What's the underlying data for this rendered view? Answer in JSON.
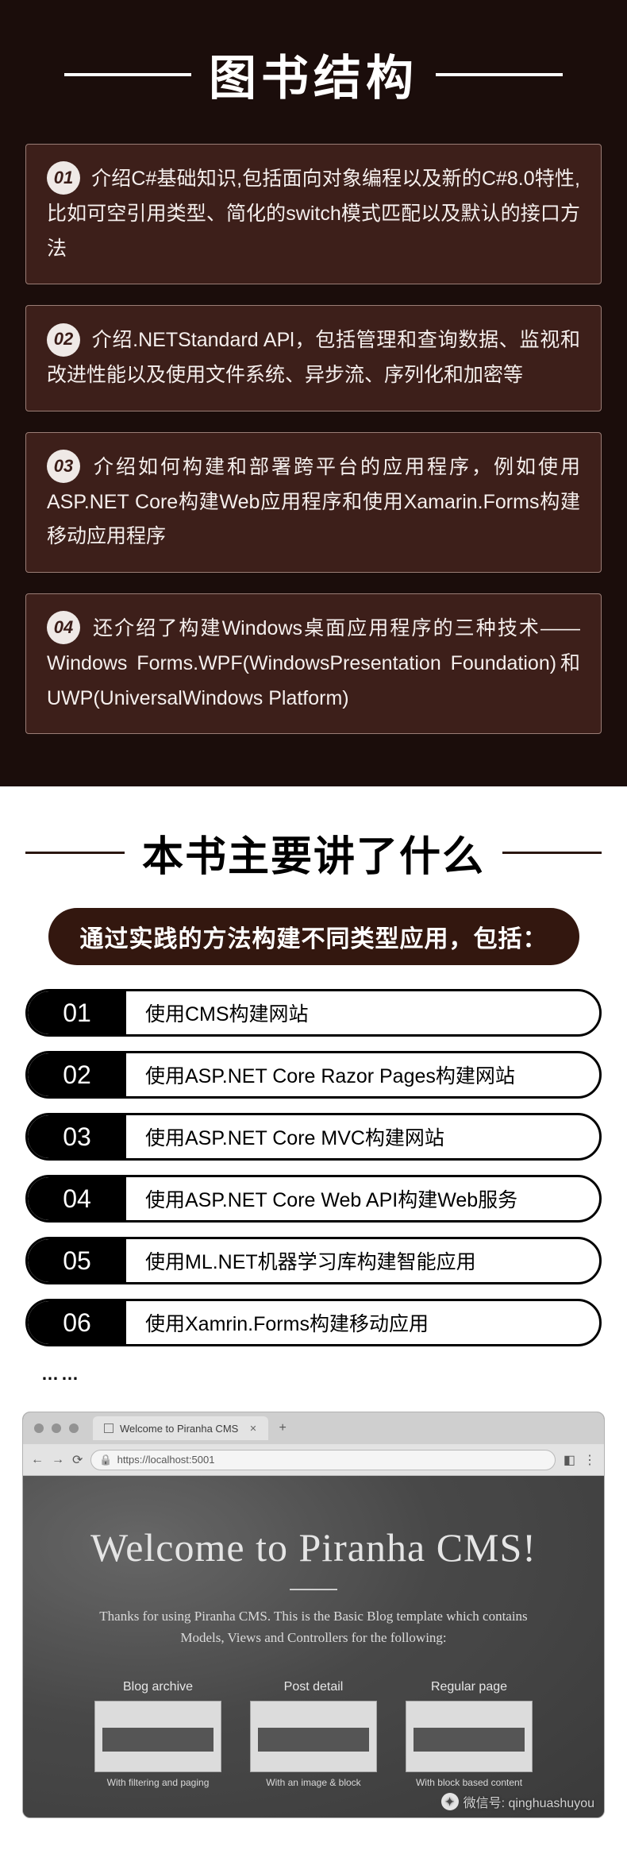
{
  "section1": {
    "title": "图书结构",
    "items": [
      {
        "num": "01",
        "text": "介绍C#基础知识,包括面向对象编程以及新的C#8.0特性,比如可空引用类型、简化的switch模式匹配以及默认的接口方法"
      },
      {
        "num": "02",
        "text": "介绍.NETStandard APl，包括管理和查询数据、监视和改进性能以及使用文件系统、异步流、序列化和加密等"
      },
      {
        "num": "03",
        "text": "介绍如何构建和部署跨平台的应用程序，例如使用ASP.NET Core构建Web应用程序和使用Xamarin.Forms构建移动应用程序"
      },
      {
        "num": "04",
        "text": "还介绍了构建Windows桌面应用程序的三种技术——Windows Forms.WPF(WindowsPresentation Foundation)和UWP(UniversalWindows Platform)"
      }
    ]
  },
  "section2": {
    "title": "本书主要讲了什么",
    "subtitle": "通过实践的方法构建不同类型应用，包括：",
    "items": [
      {
        "num": "01",
        "text": "使用CMS构建网站"
      },
      {
        "num": "02",
        "text": "使用ASP.NET Core Razor Pages构建网站"
      },
      {
        "num": "03",
        "text": "使用ASP.NET Core MVC构建网站"
      },
      {
        "num": "04",
        "text": "使用ASP.NET Core Web API构建Web服务"
      },
      {
        "num": "05",
        "text": "使用ML.NET机器学习库构建智能应用"
      },
      {
        "num": "06",
        "text": "使用Xamrin.Forms构建移动应用"
      }
    ],
    "dots": "……"
  },
  "browser": {
    "tab_title": "Welcome to Piranha CMS",
    "url": "https://localhost:5001",
    "hero_title": "Welcome to Piranha CMS!",
    "hero_sub": "Thanks for using Piranha CMS. This is the Basic Blog template which contains Models, Views and Controllers for the following:",
    "cards": [
      {
        "title": "Blog archive",
        "caption": "With filtering and paging"
      },
      {
        "title": "Post detail",
        "caption": "With an image & block"
      },
      {
        "title": "Regular page",
        "caption": "With block based content"
      }
    ]
  },
  "watermark": "微信号: qinghuashuyou"
}
